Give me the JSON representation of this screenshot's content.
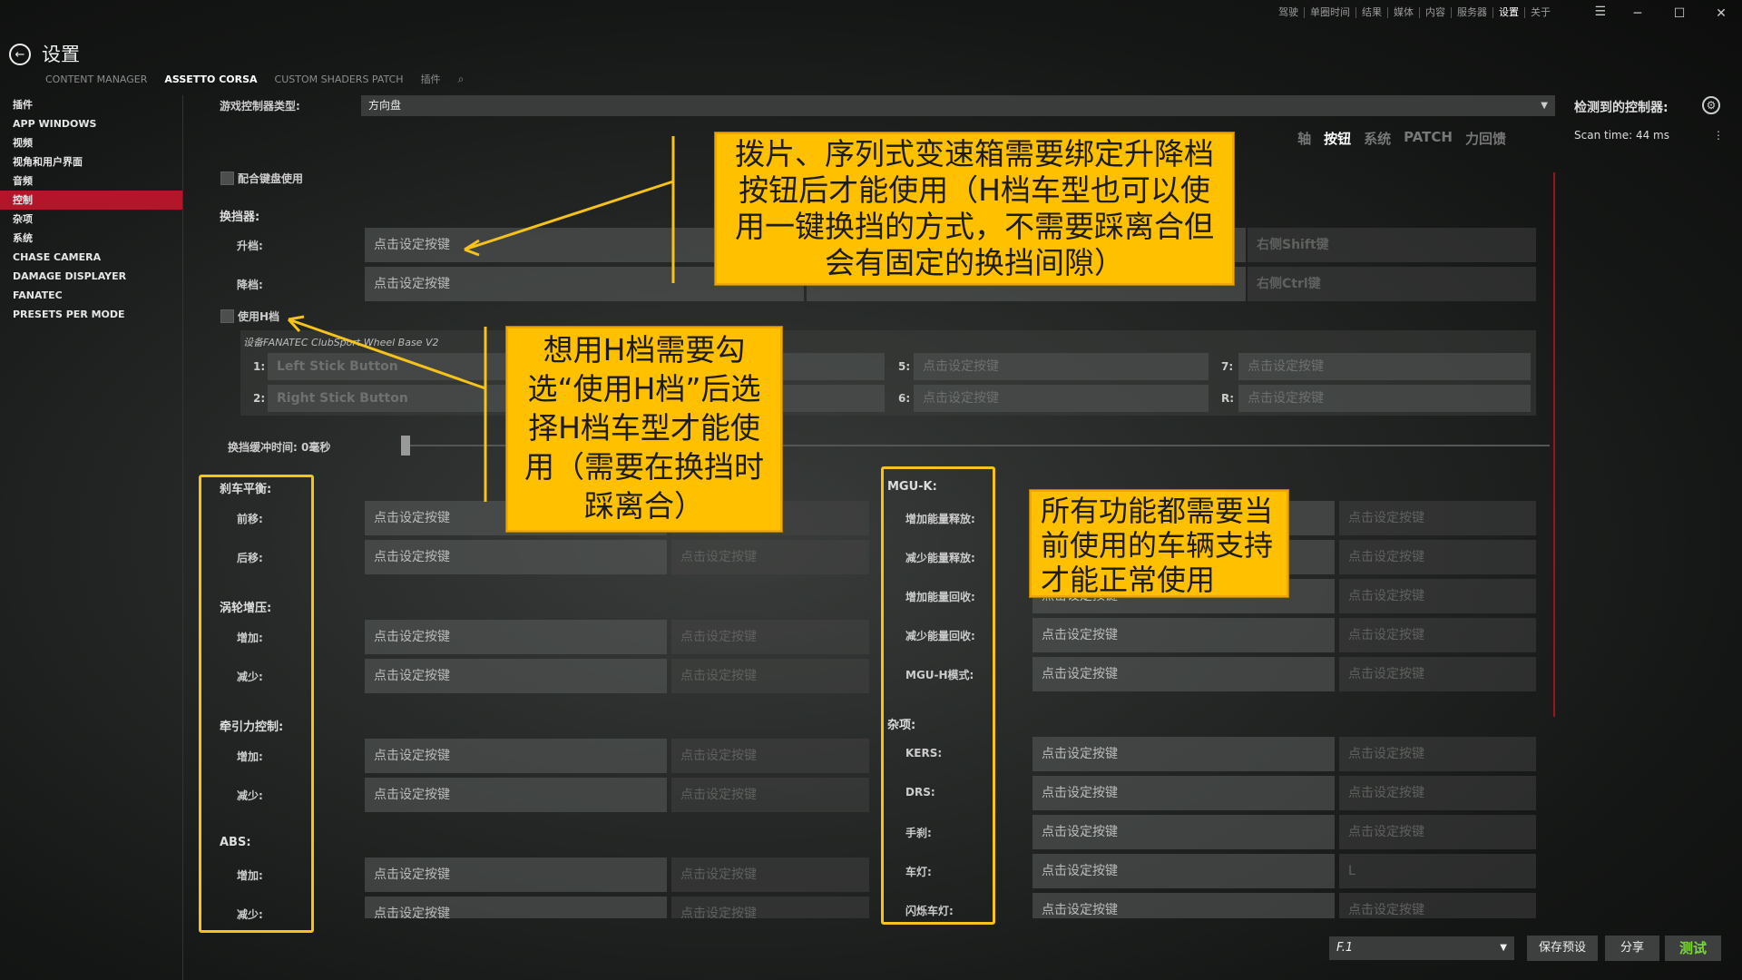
{
  "window": {
    "top_nav": [
      "驾驶",
      "单圈时间",
      "结果",
      "媒体",
      "内容",
      "服务器",
      "设置",
      "关于"
    ],
    "top_nav_active": "设置",
    "minimize": "─",
    "maximize": "☐",
    "close": "✕"
  },
  "header": {
    "title": "设置",
    "tabs": [
      "CONTENT MANAGER",
      "ASSETTO CORSA",
      "CUSTOM SHADERS PATCH",
      "插件"
    ],
    "active_tab": "ASSETTO CORSA"
  },
  "sidebar": {
    "items": [
      "插件",
      "APP WINDOWS",
      "视频",
      "视角和用户界面",
      "音频",
      "控制",
      "杂项",
      "系统",
      "CHASE CAMERA",
      "DAMAGE DISPLAYER",
      "FANATEC",
      "PRESETS PER MODE"
    ],
    "selected": "控制"
  },
  "controller": {
    "type_label": "游戏控制器类型:",
    "type_value": "方向盘",
    "detected_label": "检测到的控制器:",
    "scan_time": "Scan time: 44 ms",
    "categories": [
      "轴",
      "按钮",
      "系统",
      "PATCH",
      "力回馈"
    ],
    "active_category": "按钮"
  },
  "keyboard_combine": "配合键盘使用",
  "shifter": {
    "section": "换挡器:",
    "up_label": "升档:",
    "down_label": "降档:",
    "up_value": "点击设定按键",
    "down_value": "点击设定按键",
    "up_alt": "右侧Shift键",
    "down_alt": "右侧Ctrl键",
    "use_h": "使用H档",
    "device": "设备FANATEC ClubSport Wheel Base V2",
    "gears": [
      {
        "n": "1:",
        "v": "Left Stick Button"
      },
      {
        "n": "2:",
        "v": "Right Stick Button"
      },
      {
        "n": "5:",
        "v": "点击设定按键"
      },
      {
        "n": "6:",
        "v": "点击设定按键"
      },
      {
        "n": "7:",
        "v": "点击设定按键"
      },
      {
        "n": "R:",
        "v": "点击设定按键"
      }
    ],
    "buffer_label": "换挡缓冲时间: 0毫秒"
  },
  "left_groups": {
    "brake_balance": "刹车平衡:",
    "bb_fwd": "前移:",
    "bb_back": "后移:",
    "turbo": "涡轮增压:",
    "turbo_up": "增加:",
    "turbo_down": "减少:",
    "tc": "牵引力控制:",
    "tc_up": "增加:",
    "tc_down": "减少:",
    "abs": "ABS:",
    "abs_up": "增加:",
    "abs_down": "减少:",
    "bind": "点击设定按键"
  },
  "right_groups": {
    "mguk": "MGU-K:",
    "mguk_items": [
      "增加能量释放:",
      "减少能量释放:",
      "增加能量回收:",
      "减少能量回收:",
      "MGU-H模式:"
    ],
    "misc": "杂项:",
    "misc_items": [
      "KERS:",
      "DRS:",
      "手刹:",
      "车灯:",
      "闪烁车灯:"
    ],
    "bind": "点击设定按键",
    "light_alt": "L"
  },
  "footer": {
    "preset": "F.1",
    "save": "保存预设",
    "share": "分享",
    "test": "测试"
  },
  "annotations": {
    "paddle": "拨片、序列式变速箱需要绑定升降档按钮后才能使用（H档车型也可以使用一键换挡的方式，不需要踩离合但会有固定的换挡间隙）",
    "h_shifter": "想用H档需要勾选“使用H档”后选择H档车型才能使用（需要在换挡时踩离合）",
    "all": "所有功能都需要当前使用的车辆支持才能正常使用"
  },
  "colors": {
    "accent_red": "#b4152b",
    "callout_yellow": "#ffc000",
    "test_green": "#7dd63a"
  }
}
